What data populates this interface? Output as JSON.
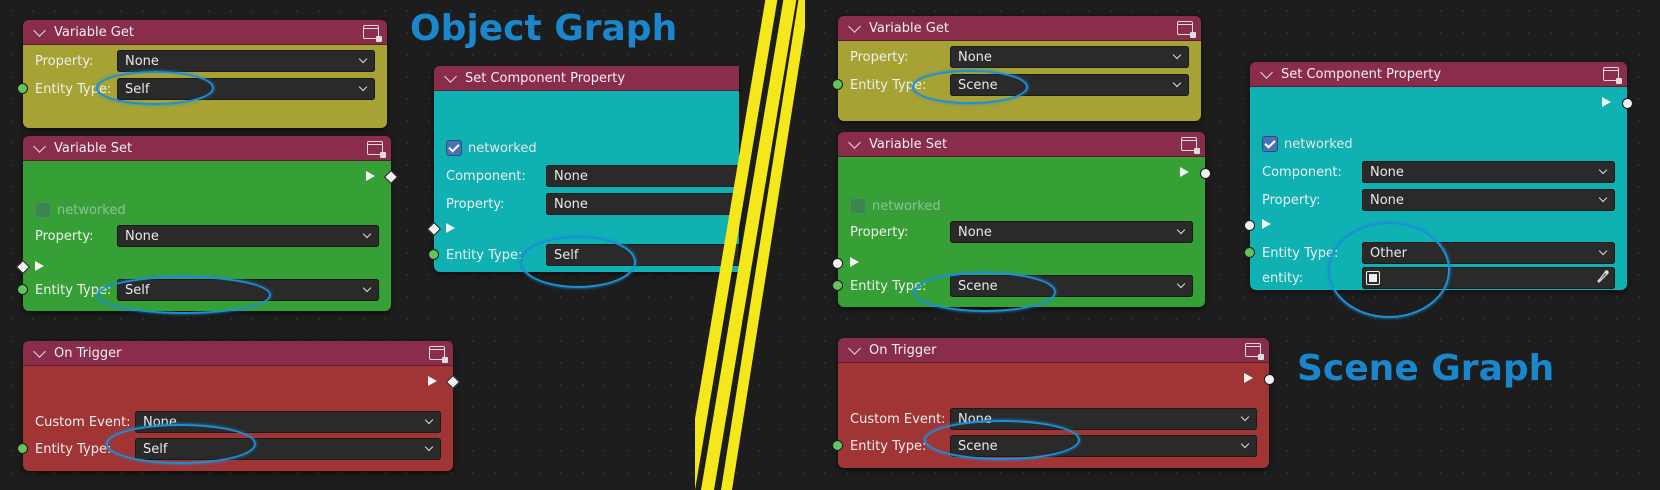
{
  "titles": {
    "object_graph": "Object Graph",
    "scene_graph": "Scene Graph"
  },
  "labels": {
    "property": "Property:",
    "entity_type": "Entity Type:",
    "component": "Component:",
    "custom_event": "Custom Event:",
    "networked": "networked",
    "entity": "entity:"
  },
  "object_graph": {
    "variable_get": {
      "title": "Variable Get",
      "property": "None",
      "entity_type": "Self"
    },
    "variable_set": {
      "title": "Variable Set",
      "networked": false,
      "property": "None",
      "entity_type": "Self"
    },
    "on_trigger": {
      "title": "On Trigger",
      "custom_event": "None",
      "entity_type": "Self"
    },
    "set_component_property": {
      "title": "Set Component Property",
      "networked": true,
      "component": "None",
      "property": "None",
      "entity_type": "Self"
    }
  },
  "scene_graph": {
    "variable_get": {
      "title": "Variable Get",
      "property": "None",
      "entity_type": "Scene"
    },
    "variable_set": {
      "title": "Variable Set",
      "networked": false,
      "property": "None",
      "entity_type": "Scene"
    },
    "on_trigger": {
      "title": "On Trigger",
      "custom_event": "None",
      "entity_type": "Scene"
    },
    "set_component_property": {
      "title": "Set Component Property",
      "networked": true,
      "component": "None",
      "property": "None",
      "entity_type": "Other",
      "entity": ""
    }
  },
  "colors": {
    "header": "#8a2d4a",
    "variable_get": "#a6a233",
    "variable_set": "#36a036",
    "on_trigger": "#a13434",
    "set_component_property": "#0fb1b3",
    "annotation": "#1c8fd6",
    "divider": "#f5e81a"
  },
  "icons": [
    "collapse-chevron-icon",
    "node-window-icon",
    "dropdown-arrow-icon",
    "checkbox-icon",
    "eyedropper-icon",
    "object-picker-icon"
  ]
}
